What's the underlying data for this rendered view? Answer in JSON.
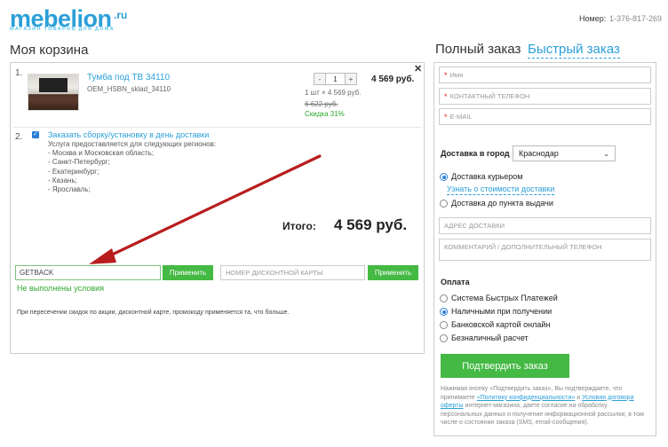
{
  "header": {
    "logo_main": "mebelion",
    "logo_suffix": ".ru",
    "logo_tagline": "МАГАЗИН ТОВАРОВ ДЛЯ ДОМА",
    "phone_label": "Номер:",
    "phone_value": "1-376-817-269"
  },
  "cart": {
    "title": "Моя корзина",
    "items": [
      {
        "index": "1.",
        "name": "Тумба под ТВ 34110",
        "sku": "OEM_HSBN_sklad_34110",
        "qty": "1",
        "qty_minus": "-",
        "qty_plus": "+",
        "price": "4 569 руб.",
        "per_unit": "1 шт × 4 569 руб.",
        "old_price": "6 622 руб.",
        "discount": "Скидка 31%"
      },
      {
        "index": "2.",
        "checked": true,
        "name": "Заказать сборку/установку в день доставки",
        "note": "Услуга предоставляется для следующих регионов:",
        "regions": [
          "- Москва и Московская область;",
          "- Санкт-Петербург;",
          "- Екатеринбург;",
          "- Казань;",
          "- Ярославль;"
        ]
      }
    ],
    "total_label": "Итого:",
    "total_value": "4 569 руб.",
    "promo_value": "GETBACK",
    "apply_label": "Применить",
    "card_placeholder": "НОМЕР ДИСКОНТНОЙ КАРТЫ",
    "conditions_text": "Не выполнены условия",
    "discount_note": "При пересечении скидок по акции, дисконтной карте, промокоду применяется та, что больше."
  },
  "order": {
    "tab_full": "Полный заказ",
    "tab_quick": "Быстрый заказ",
    "name_placeholder": "Имя",
    "phone_placeholder": "КОНТАКТНЫЙ ТЕЛЕФОН",
    "email_placeholder": "E-MAIL",
    "required_mark": "*",
    "city_label": "Доставка в город",
    "city_value": "Краснодар",
    "delivery_options": [
      {
        "label": "Доставка курьером",
        "selected": true
      },
      {
        "label": "Доставка до пункта выдачи",
        "selected": false
      }
    ],
    "delivery_cost_link": "Узнать о стоимости доставки",
    "address_placeholder": "АДРЕС ДОСТАВКИ",
    "comment_placeholder": "КОММЕНТАРИЙ / ДОПОЛНИТЕЛЬНЫЙ ТЕЛЕФОН",
    "payment_label": "Оплата",
    "payment_options": [
      {
        "label": "Система Быстрых Платежей",
        "selected": false
      },
      {
        "label": "Наличными при получении",
        "selected": true
      },
      {
        "label": "Банковской картой онлайн",
        "selected": false
      },
      {
        "label": "Безналичный расчет",
        "selected": false
      }
    ],
    "confirm_label": "Подтвердить заказ",
    "consent_1": "Нажимая кнопку «Подтвердить заказ», Вы подтверждаете, что принимаете ",
    "consent_link1": "«Политику конфиденциальности»",
    "consent_2": " и ",
    "consent_link2": "Условия договора оферты",
    "consent_3": " интернет-магазина, даете согласие на обработку персональных данных и получение информационной рассылки, в том числе о состоянии заказа (SMS, email-сообщения)."
  },
  "colors": {
    "brand": "#2b9fd8",
    "button_green": "#44b944",
    "success": "#2fa82f",
    "arrow": "#b81d1d"
  }
}
